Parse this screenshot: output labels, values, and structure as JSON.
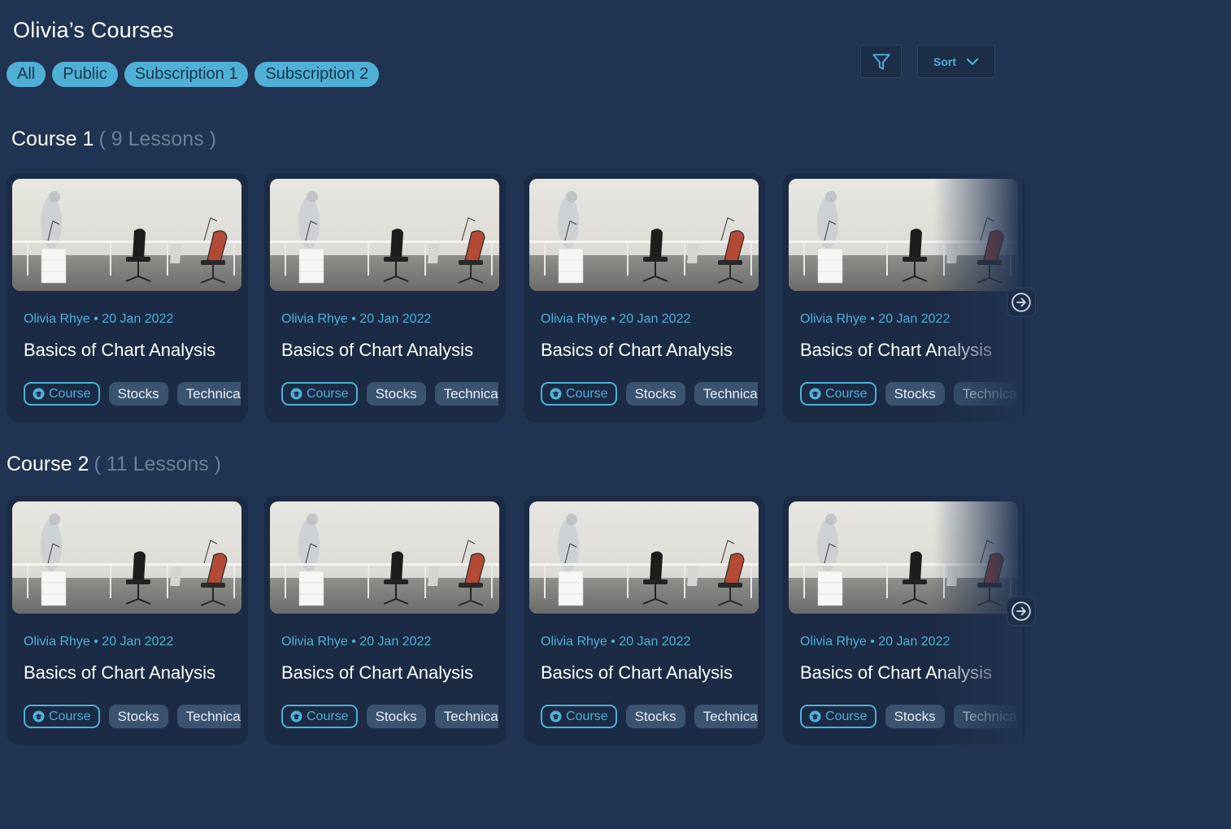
{
  "page": {
    "title": "Olivia’s Courses"
  },
  "tabs": [
    {
      "label": "All"
    },
    {
      "label": "Public"
    },
    {
      "label": "Subscription 1"
    },
    {
      "label": "Subscription 2"
    }
  ],
  "toolbar": {
    "more_label": "...",
    "filter_icon": "funnel-icon",
    "sort_label": "Sort",
    "sort_icon": "chevron-down-icon"
  },
  "colors": {
    "background": "#213352",
    "card": "#1b2b45",
    "accent": "#4fb0d5",
    "chip": "#3a5470",
    "muted": "#6f7f98"
  },
  "sections": [
    {
      "title": "Course 1",
      "count": "( 9 Lessons )",
      "cards": [
        {
          "meta": "Olivia Rhye • 20 Jan 2022",
          "title": "Basics of Chart Analysis",
          "tags": [
            "Course",
            "Stocks",
            "Technical"
          ]
        },
        {
          "meta": "Olivia Rhye • 20 Jan 2022",
          "title": "Basics of Chart Analysis",
          "tags": [
            "Course",
            "Stocks",
            "Technical"
          ]
        },
        {
          "meta": "Olivia Rhye • 20 Jan 2022",
          "title": "Basics of Chart Analysis",
          "tags": [
            "Course",
            "Stocks",
            "Technical"
          ]
        },
        {
          "meta": "Olivia Rhye • 20 Jan 2022",
          "title": "Basics of Chart Analysis",
          "tags": [
            "Course",
            "Stocks",
            "Technical"
          ]
        }
      ]
    },
    {
      "title": "Course 2",
      "count": "( 11 Lessons )",
      "cards": [
        {
          "meta": "Olivia Rhye • 20 Jan 2022",
          "title": "Basics of Chart Analysis",
          "tags": [
            "Course",
            "Stocks",
            "Technical"
          ]
        },
        {
          "meta": "Olivia Rhye • 20 Jan 2022",
          "title": "Basics of Chart Analysis",
          "tags": [
            "Course",
            "Stocks",
            "Technical"
          ]
        },
        {
          "meta": "Olivia Rhye • 20 Jan 2022",
          "title": "Basics of Chart Analysis",
          "tags": [
            "Course",
            "Stocks",
            "Technical"
          ]
        },
        {
          "meta": "Olivia Rhye • 20 Jan 2022",
          "title": "Basics of Chart Analysis",
          "tags": [
            "Course",
            "Stocks",
            "Technical"
          ]
        }
      ]
    }
  ]
}
